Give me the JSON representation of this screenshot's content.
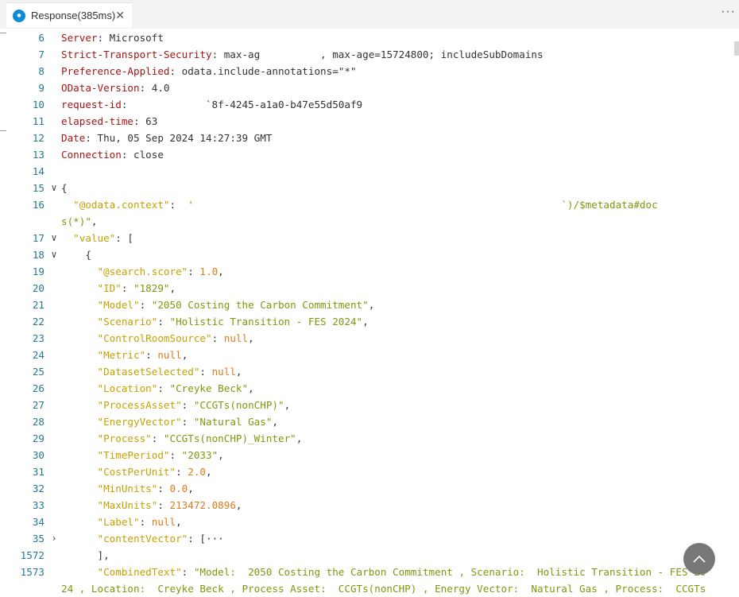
{
  "tab": {
    "title": "Response(385ms)",
    "close_glyph": "✕",
    "icon": "response-icon"
  },
  "more_glyph": "···",
  "editor": {
    "lines": [
      {
        "n": "6",
        "key": "Server",
        "val": ": Microsoft"
      },
      {
        "n": "7",
        "key": "Strict-Transport-Security",
        "val": ": max-ag          , max-age=15724800; includeSubDomains"
      },
      {
        "n": "8",
        "key": "Preference-Applied",
        "val": ": odata.include-annotations=\"*\""
      },
      {
        "n": "9",
        "key": "OData-Version",
        "val": ": 4.0"
      },
      {
        "n": "10",
        "key": "request-id",
        "val": ":             `8f-4245-a1a0-b47e55d50af9"
      },
      {
        "n": "11",
        "key": "elapsed-time",
        "val": ": 63"
      },
      {
        "n": "12",
        "key": "Date",
        "val": ": Thu, 05 Sep 2024 14:27:39 GMT"
      },
      {
        "n": "13",
        "key": "Connection",
        "val": ": close"
      },
      {
        "n": "14"
      },
      {
        "n": "15",
        "brace": "{"
      },
      {
        "n": "16",
        "jk": "\"@odata.context\"",
        "jv_pre": ":  ",
        "jv": "'                                                             `)/$metadata#docs(*)\",",
        "wrap": true
      },
      {
        "n": "17",
        "jk": "\"value\"",
        "jv_pre": ": ",
        "punct": "["
      },
      {
        "n": "18",
        "brace": "{"
      },
      {
        "n": "19",
        "jk": "\"@search.score\"",
        "jv_pre": ": ",
        "num": "1.0",
        "tail": ","
      },
      {
        "n": "20",
        "jk": "\"ID\"",
        "jv_pre": ": ",
        "str": "\"1829\"",
        "tail": ","
      },
      {
        "n": "21",
        "jk": "\"Model\"",
        "jv_pre": ": ",
        "str": "\"2050 Costing the Carbon Commitment\"",
        "tail": ","
      },
      {
        "n": "22",
        "jk": "\"Scenario\"",
        "jv_pre": ": ",
        "str": "\"Holistic Transition - FES 2024\"",
        "tail": ","
      },
      {
        "n": "23",
        "jk": "\"ControlRoomSource\"",
        "jv_pre": ": ",
        "num": "null",
        "tail": ","
      },
      {
        "n": "24",
        "jk": "\"Metric\"",
        "jv_pre": ": ",
        "num": "null",
        "tail": ","
      },
      {
        "n": "25",
        "jk": "\"DatasetSelected\"",
        "jv_pre": ": ",
        "num": "null",
        "tail": ","
      },
      {
        "n": "26",
        "jk": "\"Location\"",
        "jv_pre": ": ",
        "str": "\"Creyke Beck\"",
        "tail": ","
      },
      {
        "n": "27",
        "jk": "\"ProcessAsset\"",
        "jv_pre": ": ",
        "str": "\"CCGTs(nonCHP)\"",
        "tail": ","
      },
      {
        "n": "28",
        "jk": "\"EnergyVector\"",
        "jv_pre": ": ",
        "str": "\"Natural Gas\"",
        "tail": ","
      },
      {
        "n": "29",
        "jk": "\"Process\"",
        "jv_pre": ": ",
        "str": "\"CCGTs(nonCHP)_Winter\"",
        "tail": ","
      },
      {
        "n": "30",
        "jk": "\"TimePeriod\"",
        "jv_pre": ": ",
        "str": "\"2033\"",
        "tail": ","
      },
      {
        "n": "31",
        "jk": "\"CostPerUnit\"",
        "jv_pre": ": ",
        "num": "2.0",
        "tail": ","
      },
      {
        "n": "32",
        "jk": "\"MinUnits\"",
        "jv_pre": ": ",
        "num": "0.0",
        "tail": ","
      },
      {
        "n": "33",
        "jk": "\"MaxUnits\"",
        "jv_pre": ": ",
        "num": "213472.0896",
        "tail": ","
      },
      {
        "n": "34",
        "jk": "\"Label\"",
        "jv_pre": ": ",
        "num": "null",
        "tail": ","
      },
      {
        "n": "35",
        "jk": "\"contentVector\"",
        "jv_pre": ": ",
        "punct": "[···"
      },
      {
        "n": "1572",
        "punct": "],"
      },
      {
        "n": "1573",
        "jk": "\"CombinedText\"",
        "jv_pre": ": ",
        "str": "\"Model:  2050 Costing the Carbon Commitment , Scenario:  Holistic Transition - FES 20",
        "wrap2": "24 , Location:  Creyke Beck , Process Asset:  CCGTs(nonCHP) , Energy Vector:  Natural Gas , Process:  CCGTs"
      }
    ]
  },
  "colors": {
    "accent": "#0c8bd6",
    "line_number": "#237893",
    "fab": "#777777"
  },
  "fab": {
    "icon": "chevron-up-icon"
  }
}
